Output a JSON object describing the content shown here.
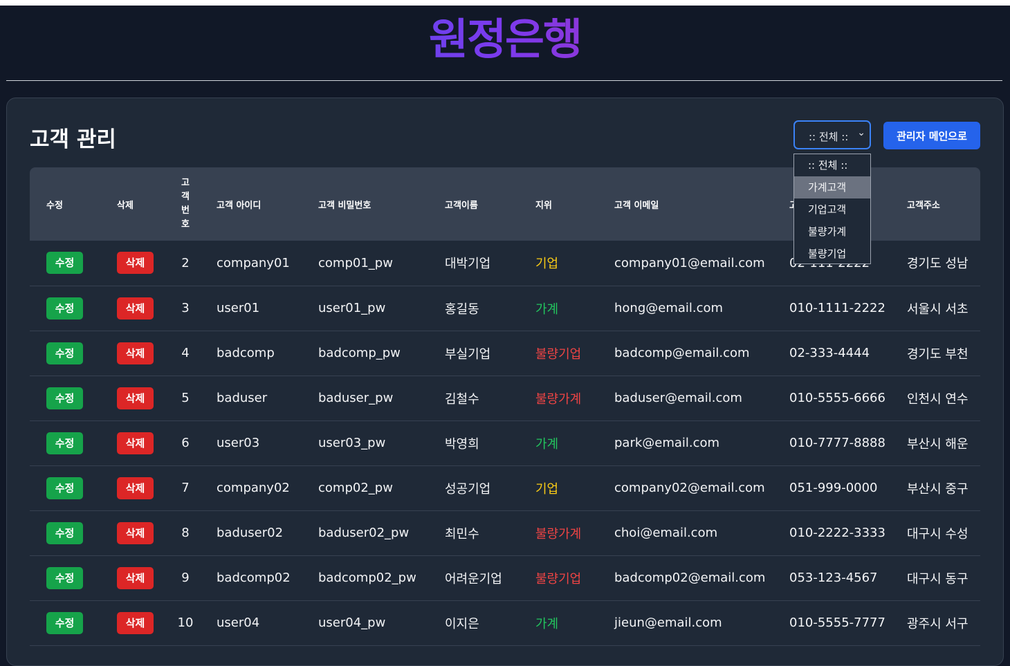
{
  "brand": "원정은행",
  "page_title": "고객 관리",
  "filter": {
    "selected": ":: 전체 ::",
    "options": [
      ":: 전체 ::",
      "가계고객",
      "기업고객",
      "불량가계",
      "불량기업"
    ],
    "highlighted_index": 1
  },
  "admin_button_label": "관리자 메인으로",
  "columns": {
    "edit": "수정",
    "delete": "삭제",
    "no_chars": [
      "고",
      "객",
      "번",
      "호"
    ],
    "id": "고객 아이디",
    "pw": "고객 비밀번호",
    "name": "고객이름",
    "grade": "지위",
    "email": "고객 이메일",
    "phone": "고객 전화번호",
    "address": "고객주소"
  },
  "row_buttons": {
    "edit": "수정",
    "delete": "삭제"
  },
  "rows": [
    {
      "no": "2",
      "id": "company01",
      "pw": "comp01_pw",
      "name": "대박기업",
      "grade": "기업",
      "email": "company01@email.com",
      "phone": "02-111-2222",
      "address": "경기도 성남"
    },
    {
      "no": "3",
      "id": "user01",
      "pw": "user01_pw",
      "name": "홍길동",
      "grade": "가계",
      "email": "hong@email.com",
      "phone": "010-1111-2222",
      "address": "서울시 서초"
    },
    {
      "no": "4",
      "id": "badcomp",
      "pw": "badcomp_pw",
      "name": "부실기업",
      "grade": "불량기업",
      "email": "badcomp@email.com",
      "phone": "02-333-4444",
      "address": "경기도 부천"
    },
    {
      "no": "5",
      "id": "baduser",
      "pw": "baduser_pw",
      "name": "김철수",
      "grade": "불량가계",
      "email": "baduser@email.com",
      "phone": "010-5555-6666",
      "address": "인천시 연수"
    },
    {
      "no": "6",
      "id": "user03",
      "pw": "user03_pw",
      "name": "박영희",
      "grade": "가계",
      "email": "park@email.com",
      "phone": "010-7777-8888",
      "address": "부산시 해운"
    },
    {
      "no": "7",
      "id": "company02",
      "pw": "comp02_pw",
      "name": "성공기업",
      "grade": "기업",
      "email": "company02@email.com",
      "phone": "051-999-0000",
      "address": "부산시 중구"
    },
    {
      "no": "8",
      "id": "baduser02",
      "pw": "baduser02_pw",
      "name": "최민수",
      "grade": "불량가계",
      "email": "choi@email.com",
      "phone": "010-2222-3333",
      "address": "대구시 수성"
    },
    {
      "no": "9",
      "id": "badcomp02",
      "pw": "badcomp02_pw",
      "name": "어려운기업",
      "grade": "불량기업",
      "email": "badcomp02@email.com",
      "phone": "053-123-4567",
      "address": "대구시 동구"
    },
    {
      "no": "10",
      "id": "user04",
      "pw": "user04_pw",
      "name": "이지은",
      "grade": "가계",
      "email": "jieun@email.com",
      "phone": "010-5555-7777",
      "address": "광주시 서구"
    }
  ],
  "colors": {
    "grade_business": "#facc15",
    "grade_household": "#22c55e",
    "grade_bad": "#ef4444",
    "edit_button": "#16a34a",
    "delete_button": "#dc2626",
    "primary": "#2563eb"
  }
}
